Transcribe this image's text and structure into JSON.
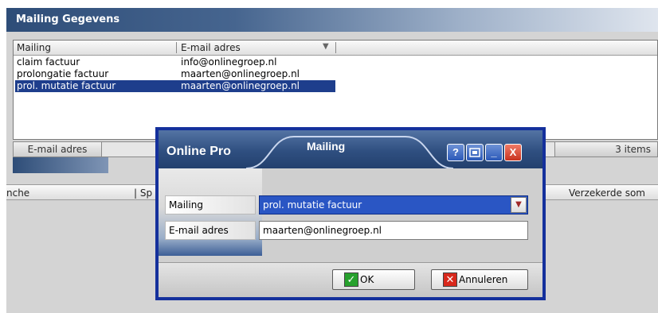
{
  "panel": {
    "title": "Mailing Gegevens",
    "columns": [
      "Mailing",
      "E-mail adres"
    ],
    "rows": [
      {
        "mailing": "claim factuur",
        "email": "info@onlinegroep.nl"
      },
      {
        "mailing": "prolongatie factuur",
        "email": "maarten@onlinegroep.nl"
      },
      {
        "mailing": "prol. mutatie factuur",
        "email": "maarten@onlinegroep.nl"
      }
    ],
    "selected_row": 2,
    "status_left": "E-mail adres",
    "status_right": "3 items"
  },
  "grid2": {
    "col1": "nche",
    "col2": "Sp",
    "col3": "Verzekerde som"
  },
  "dialog": {
    "brand": "Online Pro",
    "title": "Mailing",
    "help_glyph": "?",
    "min_glyph": "_",
    "close_glyph": "X",
    "fields": {
      "mailing_label": "Mailing",
      "mailing_value": "prol. mutatie factuur",
      "email_label": "E-mail adres",
      "email_value": "maarten@onlinegroep.nl"
    },
    "ok_label": "OK",
    "cancel_label": "Annuleren",
    "ok_glyph": "✓",
    "cancel_glyph": "✕"
  },
  "colors": {
    "selection": "#1e3e8c",
    "dialog_border": "#14309c",
    "ok_icon": "#27a12d",
    "cancel_icon": "#d8281c"
  }
}
